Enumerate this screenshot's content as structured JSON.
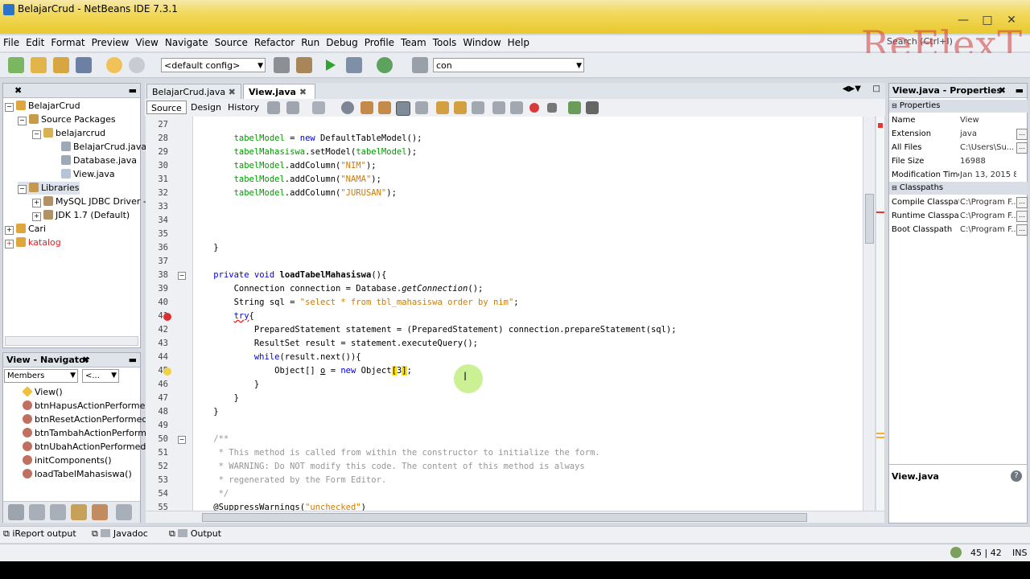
{
  "window": {
    "title": "BelajarCrud - NetBeans IDE 7.3.1"
  },
  "menu": [
    "File",
    "Edit",
    "Format",
    "Preview",
    "View",
    "Navigate",
    "Source",
    "Refactor",
    "Run",
    "Debug",
    "Profile",
    "Team",
    "Tools",
    "Window",
    "Help"
  ],
  "search": {
    "placeholder": "Search (Ctrl+I)"
  },
  "watermark": "ReElexT",
  "toolbar": {
    "config": "<default config>",
    "search_combo": "con"
  },
  "projects": {
    "tree": [
      {
        "label": "BelajarCrud",
        "level": 0
      },
      {
        "label": "Source Packages",
        "level": 1
      },
      {
        "label": "belajarcrud",
        "level": 2
      },
      {
        "label": "BelajarCrud.java",
        "level": 3
      },
      {
        "label": "Database.java",
        "level": 3
      },
      {
        "label": "View.java",
        "level": 3
      },
      {
        "label": "Libraries",
        "level": 1
      },
      {
        "label": "MySQL JDBC Driver -",
        "level": 2
      },
      {
        "label": "JDK 1.7 (Default)",
        "level": 2
      },
      {
        "label": "Cari",
        "level": 0
      },
      {
        "label": "katalog",
        "level": 0
      }
    ]
  },
  "navigator": {
    "title": "View - Navigator",
    "filter": "Members",
    "filter2": "<...",
    "items": [
      "View()",
      "btnHapusActionPerforme",
      "btnResetActionPerformed",
      "btnTambahActionPerform",
      "btnUbahActionPerformed",
      "initComponents()",
      "loadTabelMahasiswa()"
    ]
  },
  "editor": {
    "tabs": [
      "BelajarCrud.java",
      "View.java"
    ],
    "views": [
      "Source",
      "Design",
      "History"
    ]
  },
  "code": [
    {
      "n": "27",
      "t": ""
    },
    {
      "n": "28",
      "t": "        tabelModel = new DefaultTableModel();"
    },
    {
      "n": "29",
      "t": "        tabelMahasiswa.setModel(tabelModel);"
    },
    {
      "n": "30",
      "t": "        tabelModel.addColumn(\"NIM\");"
    },
    {
      "n": "31",
      "t": "        tabelModel.addColumn(\"NAMA\");"
    },
    {
      "n": "32",
      "t": "        tabelModel.addColumn(\"JURUSAN\");"
    },
    {
      "n": "33",
      "t": ""
    },
    {
      "n": "34",
      "t": ""
    },
    {
      "n": "35",
      "t": ""
    },
    {
      "n": "36",
      "t": "    }"
    },
    {
      "n": "37",
      "t": ""
    },
    {
      "n": "38",
      "t": "    private void loadTabelMahasiswa(){"
    },
    {
      "n": "39",
      "t": "        Connection connection = Database.getConnection();"
    },
    {
      "n": "40",
      "t": "        String sql = \"select * from tbl_mahasiswa order by nim\";"
    },
    {
      "n": "41",
      "t": "        try{"
    },
    {
      "n": "42",
      "t": "            PreparedStatement statement = (PreparedStatement) connection.prepareStatement(sql);"
    },
    {
      "n": "43",
      "t": "            ResultSet result = statement.executeQuery();"
    },
    {
      "n": "44",
      "t": "            while(result.next()){"
    },
    {
      "n": "45",
      "t": "                Object[] o = new Object[3];"
    },
    {
      "n": "46",
      "t": "            }"
    },
    {
      "n": "47",
      "t": "        }"
    },
    {
      "n": "48",
      "t": "    }"
    },
    {
      "n": "49",
      "t": ""
    },
    {
      "n": "50",
      "t": "    /**"
    },
    {
      "n": "51",
      "t": "     * This method is called from within the constructor to initialize the form."
    },
    {
      "n": "52",
      "t": "     * WARNING: Do NOT modify this code. The content of this method is always"
    },
    {
      "n": "53",
      "t": "     * regenerated by the Form Editor."
    },
    {
      "n": "54",
      "t": "     */"
    },
    {
      "n": "55",
      "t": "    @SuppressWarnings(\"unchecked\")"
    }
  ],
  "properties": {
    "title": "View.java - Properties",
    "section1": "Properties",
    "rows1": [
      {
        "k": "Name",
        "v": "View"
      },
      {
        "k": "Extension",
        "v": "java"
      },
      {
        "k": "All Files",
        "v": "C:\\Users\\Su..."
      },
      {
        "k": "File Size",
        "v": "16988"
      },
      {
        "k": "Modification Time",
        "v": "Jan 13, 2015 8:..."
      }
    ],
    "section2": "Classpaths",
    "rows2": [
      {
        "k": "Compile Classpath",
        "v": "C:\\Program F..."
      },
      {
        "k": "Runtime Classpath",
        "v": "C:\\Program F..."
      },
      {
        "k": "Boot Classpath",
        "v": "C:\\Program F..."
      }
    ],
    "footer": "View.java"
  },
  "bottom_tabs": [
    "iReport output",
    "Javadoc",
    "Output"
  ],
  "status": {
    "position": "45 | 42",
    "mode": "INS"
  },
  "colors": {
    "keyword": "#0000e6",
    "field": "#009900",
    "string": "#ce7b00",
    "comment": "#969696"
  }
}
